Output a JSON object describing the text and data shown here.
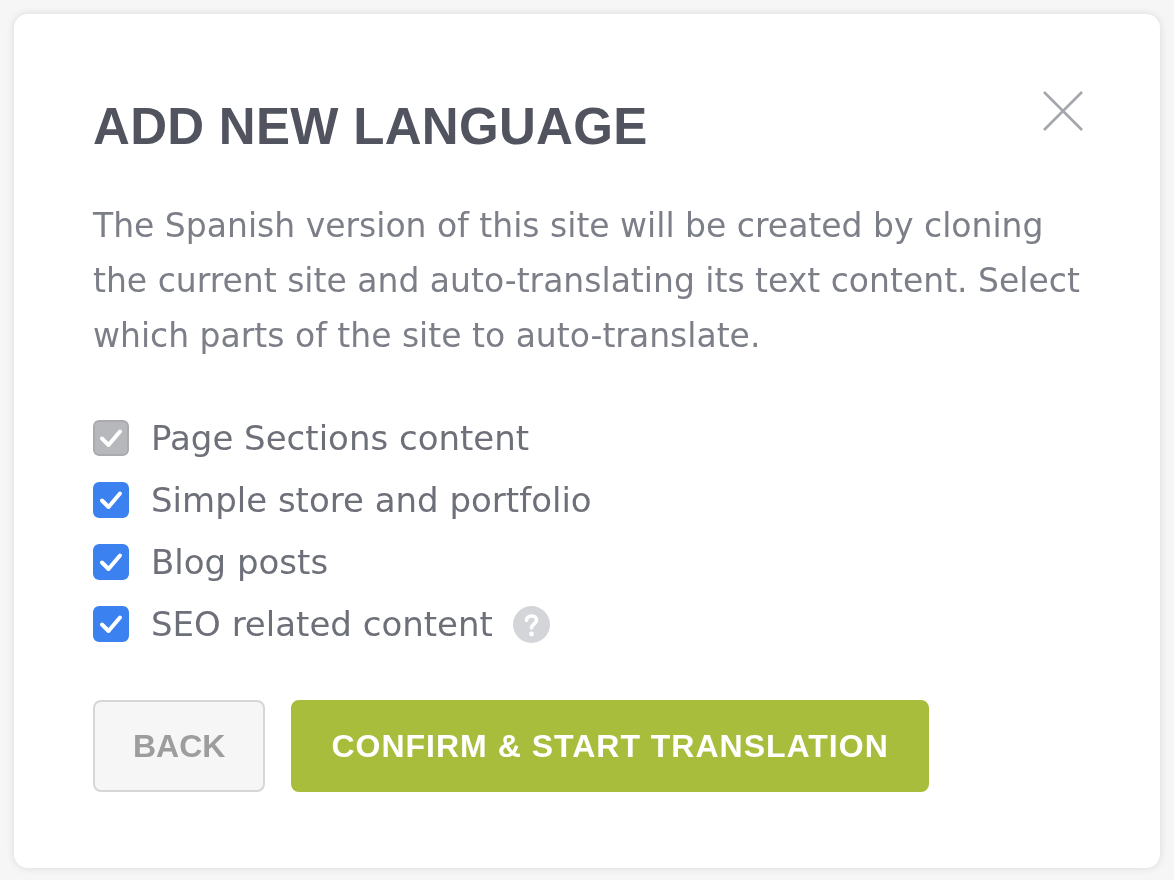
{
  "dialog": {
    "title": "ADD NEW LANGUAGE",
    "description": "The Spanish version of this site will be created by cloning the current site and auto-translating its text content. Select which parts of the site to auto-translate.",
    "options": [
      {
        "label": "Page Sections content",
        "checked": true,
        "disabled": true,
        "help": false
      },
      {
        "label": "Simple store and portfolio",
        "checked": true,
        "disabled": false,
        "help": false
      },
      {
        "label": "Blog posts",
        "checked": true,
        "disabled": false,
        "help": false
      },
      {
        "label": "SEO related content",
        "checked": true,
        "disabled": false,
        "help": true
      }
    ],
    "buttons": [
      {
        "label": "BACK",
        "kind": "secondary"
      },
      {
        "label": "CONFIRM & START TRANSLATION",
        "kind": "primary"
      }
    ]
  }
}
